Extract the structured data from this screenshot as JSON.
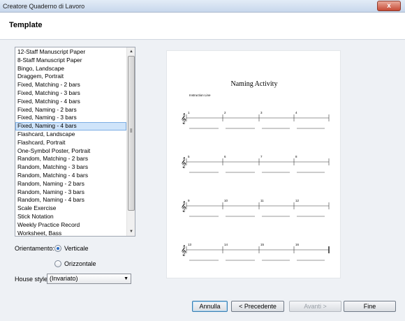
{
  "window": {
    "title": "Creatore Quaderno di Lavoro",
    "close_glyph": "x"
  },
  "header": {
    "heading": "Template"
  },
  "template_list": {
    "items": [
      "12-Staff Manuscript Paper",
      "8-Staff Manuscript Paper",
      "Bingo, Landscape",
      "Draggem, Portrait",
      "Fixed, Matching - 2 bars",
      "Fixed, Matching - 3 bars",
      "Fixed, Matching - 4 bars",
      "Fixed, Naming - 2 bars",
      "Fixed, Naming - 3 bars",
      "Fixed, Naming - 4 bars",
      "Flashcard, Landscape",
      "Flashcard, Portrait",
      "One-Symbol Poster, Portrait",
      "Random, Matching - 2 bars",
      "Random, Matching - 3 bars",
      "Random, Matching - 4 bars",
      "Random, Naming - 2 bars",
      "Random, Naming - 3 bars",
      "Random, Naming - 4 bars",
      "Scale Exercise",
      "Stick Notation",
      "Weekly Practice Record",
      "Worksheet, Bass"
    ],
    "selected_index": 9
  },
  "orientation": {
    "label": "Orientamento:",
    "options": [
      "Verticale",
      "Orizzontale"
    ],
    "selected": "Verticale"
  },
  "house_style": {
    "label": "House style:",
    "value": "(Invariato)"
  },
  "preview": {
    "title": "Naming Activity",
    "instruction": "Instruction Line",
    "bar_numbers": [
      [
        "1",
        "2",
        "3",
        "4"
      ],
      [
        "5",
        "6",
        "7",
        "8"
      ],
      [
        "9",
        "10",
        "11",
        "12"
      ],
      [
        "13",
        "14",
        "15",
        "16"
      ]
    ]
  },
  "buttons": {
    "cancel": "Annulla",
    "back": "< Precedente",
    "next": "Avanti >",
    "finish": "Fine"
  }
}
